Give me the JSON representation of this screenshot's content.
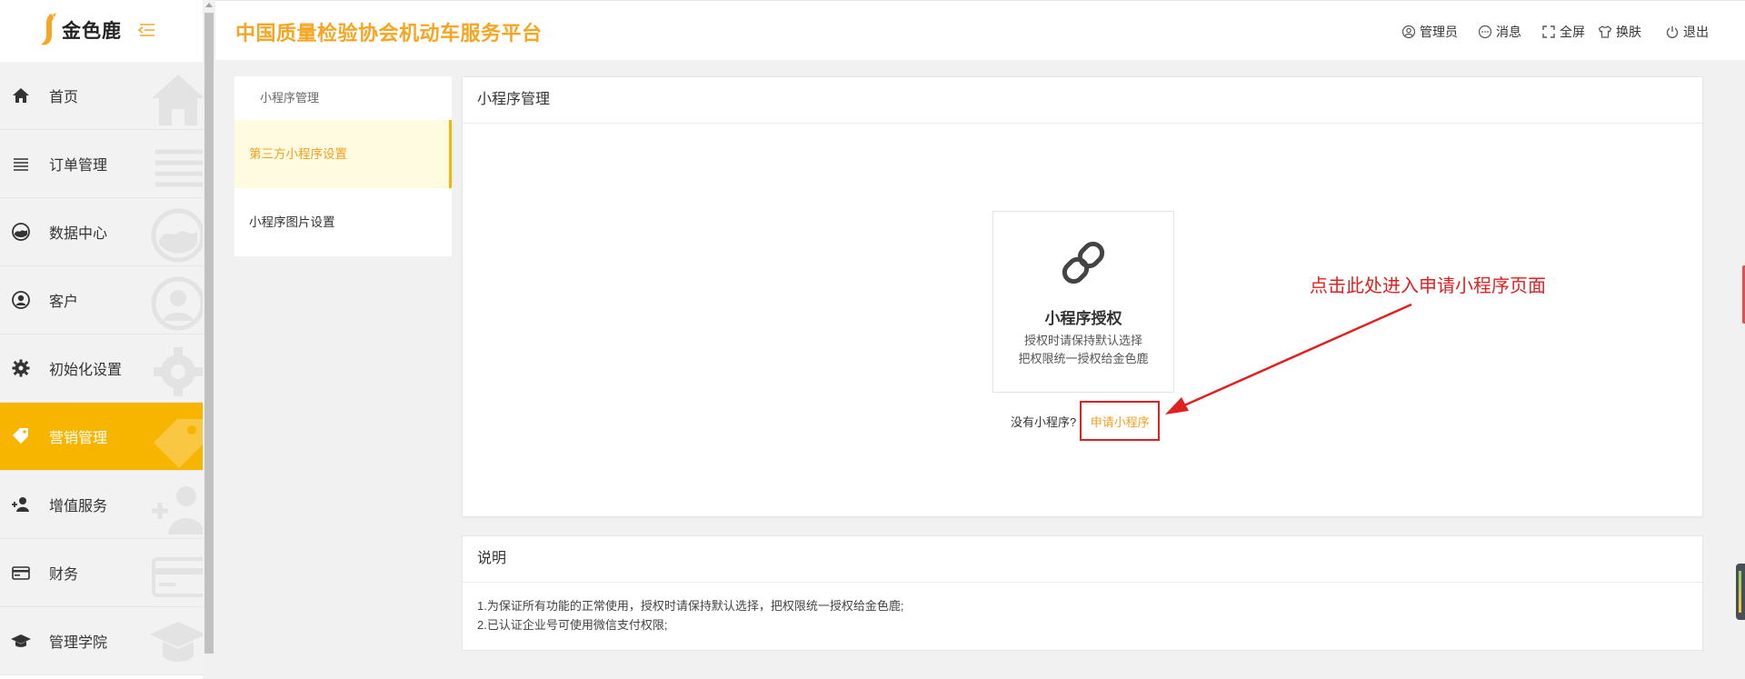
{
  "logo": {
    "text": "金色鹿"
  },
  "header": {
    "title": "中国质量检验协会机动车服务平台",
    "actions": [
      {
        "label": "管理员",
        "icon": "user-circle-icon"
      },
      {
        "label": "消息",
        "icon": "message-icon"
      },
      {
        "label": "全屏",
        "icon": "fullscreen-icon"
      },
      {
        "label": "换肤",
        "icon": "shirt-icon"
      },
      {
        "label": "退出",
        "icon": "power-icon"
      }
    ]
  },
  "sidebar": {
    "items": [
      {
        "label": "首页",
        "icon": "home-icon",
        "active": false
      },
      {
        "label": "订单管理",
        "icon": "list-icon",
        "active": false
      },
      {
        "label": "数据中心",
        "icon": "dashboard-icon",
        "active": false
      },
      {
        "label": "客户",
        "icon": "user-icon",
        "active": false
      },
      {
        "label": "初始化设置",
        "icon": "gear-icon",
        "active": false
      },
      {
        "label": "营销管理",
        "icon": "tag-icon",
        "active": true
      },
      {
        "label": "增值服务",
        "icon": "add-user-icon",
        "active": false
      },
      {
        "label": "财务",
        "icon": "card-icon",
        "active": false
      },
      {
        "label": "管理学院",
        "icon": "graduation-cap-icon",
        "active": false
      }
    ]
  },
  "submenu": {
    "heading": "小程序管理",
    "items": [
      {
        "label": "第三方小程序设置",
        "active": true
      },
      {
        "label": "小程序图片设置",
        "active": false
      }
    ]
  },
  "main": {
    "card_title": "小程序管理",
    "auth": {
      "title": "小程序授权",
      "line1": "授权时请保持默认选择",
      "line2": "把权限统一授权给金色鹿"
    },
    "apply": {
      "prompt": "没有小程序?",
      "link": "申请小程序"
    },
    "annotation": "点击此处进入申请小程序页面"
  },
  "note": {
    "title": "说明",
    "lines": [
      "1.为保证所有功能的正常使用，授权时请保持默认选择，把权限统一授权给金色鹿;",
      "2.已认证企业号可使用微信支付权限;"
    ]
  },
  "colors": {
    "accent": "#f8b500",
    "title": "#f5a623",
    "annotation": "#e02020"
  }
}
